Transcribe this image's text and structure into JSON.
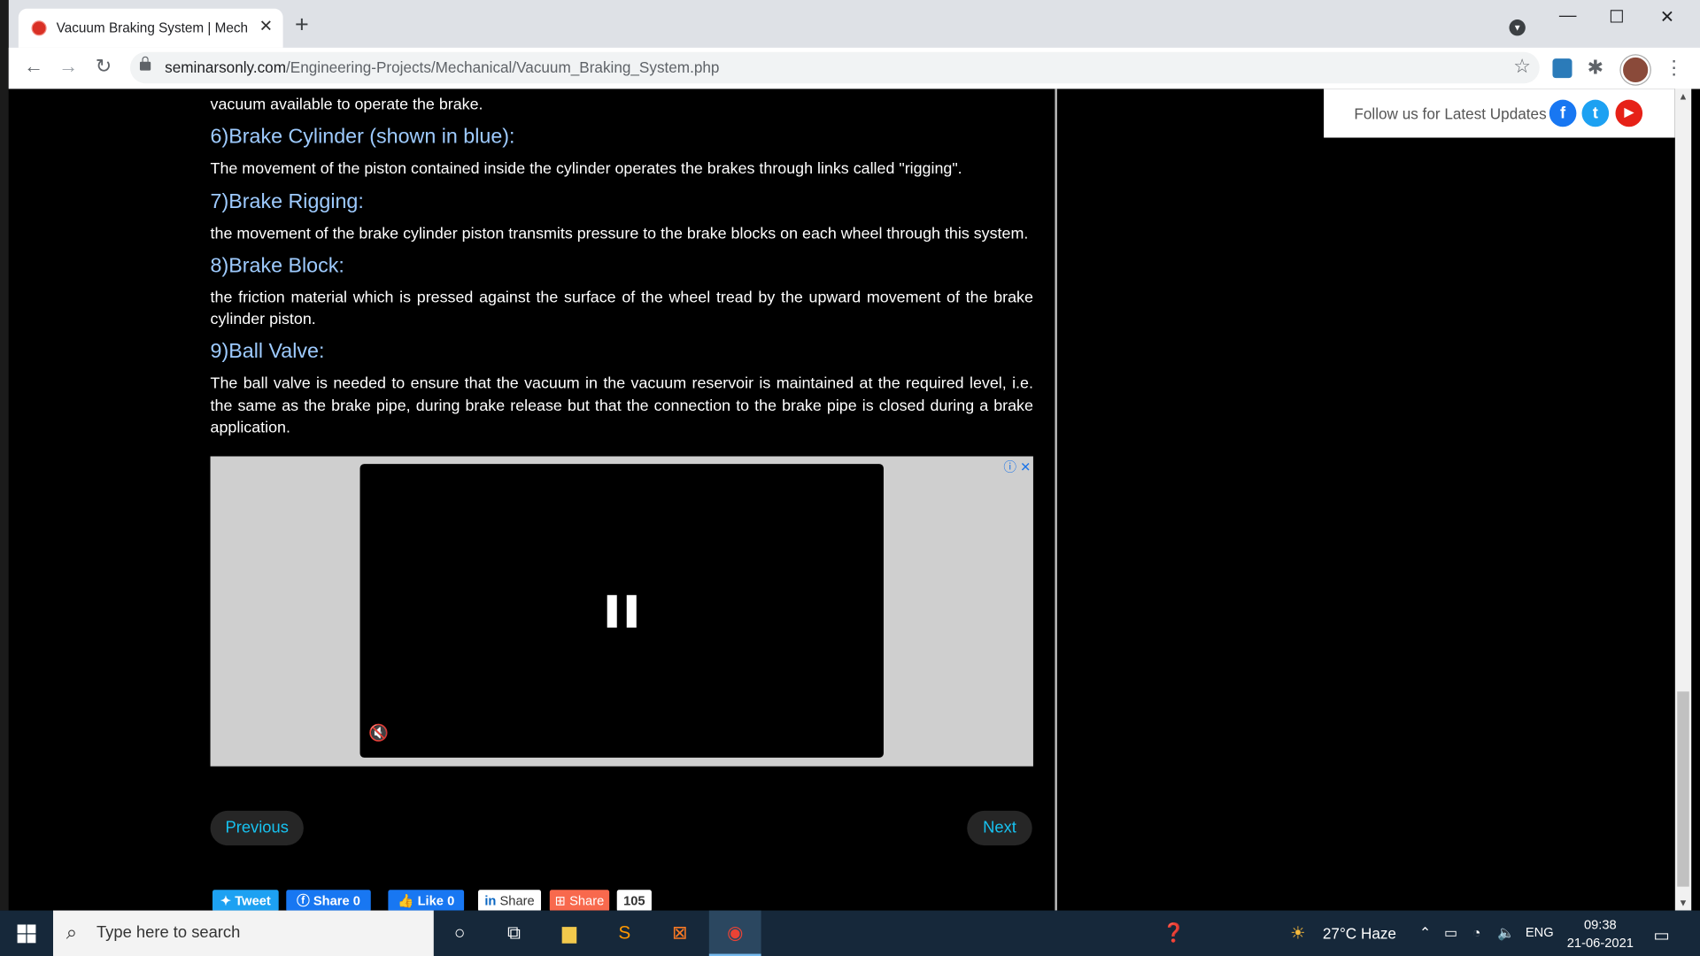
{
  "browser": {
    "tab_title": "Vacuum Braking System | Mechanical",
    "tab_close": "✕",
    "new_tab": "+",
    "url_domain": "seminarsonly.com",
    "url_path": "/Engineering-Projects/Mechanical/Vacuum_Braking_System.php",
    "win_minimize": "—",
    "win_maximize": "☐",
    "win_close": "✕"
  },
  "article": {
    "partial_line": "vacuum available to operate the brake.",
    "sections": [
      {
        "heading": "6)Brake Cylinder (shown in blue):",
        "body": "The movement of the piston contained inside the cylinder operates the brakes through links called \"rigging\"."
      },
      {
        "heading": "7)Brake Rigging:",
        "body": "the movement of the brake cylinder piston transmits pressure to the brake blocks on each wheel through this system."
      },
      {
        "heading": "8)Brake Block:",
        "body": "the friction material which is pressed against the surface of the wheel tread by the upward movement of the brake cylinder piston."
      },
      {
        "heading": "9)Ball Valve:",
        "body": "The ball valve is needed to ensure that the vacuum in the vacuum reservoir is maintained at the required level, i.e. the same as the brake pipe, during brake release but that the connection to the brake pipe is closed during a brake application."
      }
    ]
  },
  "sidebar": {
    "follow_text": "Follow us for Latest Updates",
    "social": [
      {
        "icon": "facebook-icon",
        "glyph": "f",
        "color": "#1877f2"
      },
      {
        "icon": "twitter-icon",
        "glyph": "t",
        "color": "#1da1f2"
      },
      {
        "icon": "youtube-icon",
        "glyph": "▶",
        "color": "#e62117"
      }
    ]
  },
  "ad": {
    "info": "ⓘ",
    "close": "✕"
  },
  "pagination": {
    "previous": "Previous",
    "next": "Next"
  },
  "share_bar": {
    "tweet": "Tweet",
    "facebook": "Share 0",
    "like": "Like 0",
    "linkedin": "Share",
    "addthis": "Share",
    "count": "105"
  },
  "taskbar": {
    "search_placeholder": "Type here to search",
    "weather": "27°C  Haze",
    "language": "ENG",
    "time": "09:38",
    "date": "21-06-2021"
  }
}
